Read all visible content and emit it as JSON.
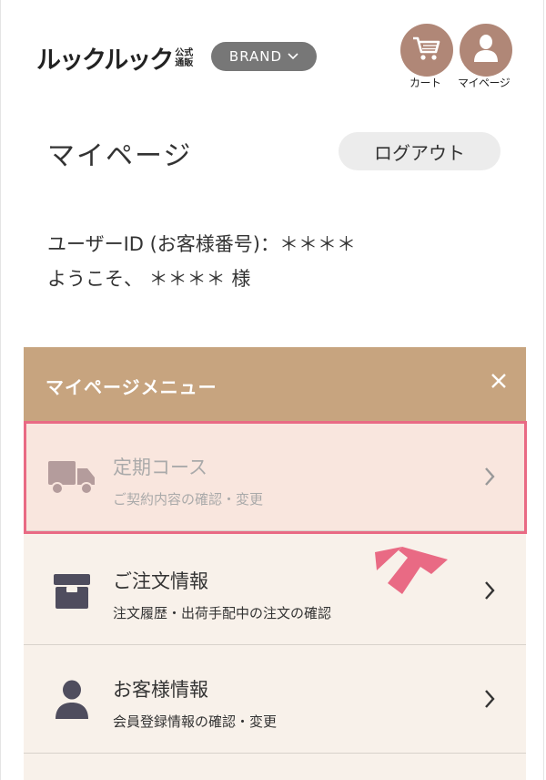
{
  "header": {
    "logo_main": "ルックルック",
    "logo_sub_1": "公式",
    "logo_sub_2": "通販",
    "brand_label": "BRAND",
    "cart_label": "カート",
    "mypage_label": "マイページ",
    "icons": {
      "cart": "cart-icon",
      "mypage": "user-icon",
      "brand_chevron": "chevron-down-icon"
    },
    "accent_color": "#b08777"
  },
  "page": {
    "title": "マイページ",
    "logout_label": "ログアウト",
    "user_id_line": "ユーザーID (お客様番号)：＊＊＊＊",
    "welcome_line": "ようこそ、 ＊＊＊＊ 様"
  },
  "menu": {
    "title": "マイページメニュー",
    "close_icon": "close-icon",
    "header_color": "#c7a47f",
    "items": [
      {
        "label": "定期コース",
        "desc": "ご契約内容の確認・変更",
        "icon": "truck-icon",
        "highlighted": true
      },
      {
        "label": "ご注文情報",
        "desc": "注文履歴・出荷手配中の注文の確認",
        "icon": "box-icon"
      },
      {
        "label": "お客様情報",
        "desc": "会員登録情報の確認・変更",
        "icon": "person-icon"
      }
    ]
  },
  "annotation": {
    "highlight_color": "#e96a84",
    "pointer_icon": "arrow-pointer-icon"
  }
}
